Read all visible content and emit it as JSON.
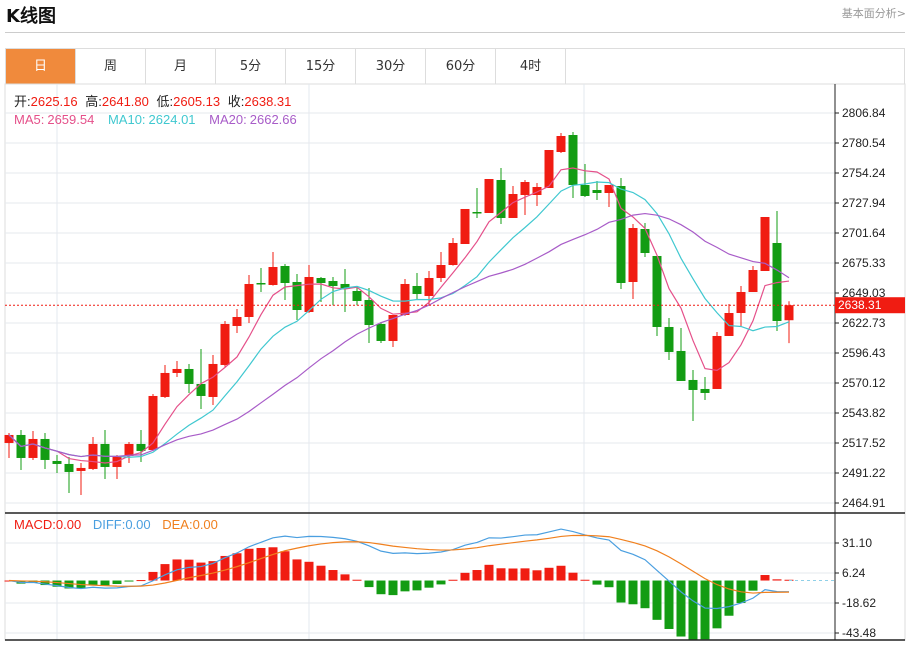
{
  "header": {
    "title": "K线图",
    "link": "基本面分析>"
  },
  "tabs": [
    {
      "label": "日",
      "active": true
    },
    {
      "label": "周"
    },
    {
      "label": "月"
    },
    {
      "label": "5分"
    },
    {
      "label": "15分"
    },
    {
      "label": "30分"
    },
    {
      "label": "60分"
    },
    {
      "label": "4时"
    }
  ],
  "info": {
    "open_label": "开:",
    "open": "2625.16",
    "high_label": "高:",
    "high": "2641.80",
    "low_label": "低:",
    "low": "2605.13",
    "close_label": "收:",
    "close": "2638.31",
    "ma5_label": "MA5:",
    "ma5": "2659.54",
    "ma10_label": "MA10:",
    "ma10": "2624.01",
    "ma20_label": "MA20:",
    "ma20": "2662.66"
  },
  "macd_info": {
    "macd": "MACD:0.00",
    "diff": "DIFF:0.00",
    "dea": "DEA:0.00"
  },
  "colors": {
    "up": "#f01c12",
    "down": "#139c13",
    "ma5": "#e5508a",
    "ma10": "#40c8d0",
    "ma20": "#a85cc8",
    "diff": "#4a9fe0",
    "dea": "#f0801e",
    "accent": "#f08a3c"
  },
  "chart_data": {
    "type": "candlestick",
    "price_axis": {
      "ticks": [
        "2806.84",
        "2780.54",
        "2754.24",
        "2727.94",
        "2701.64",
        "2675.33",
        "2649.03",
        "2622.73",
        "2596.43",
        "2570.12",
        "2543.82",
        "2517.52",
        "2491.22",
        "2464.91"
      ],
      "range": [
        2464.91,
        2806.84
      ]
    },
    "last_price": "2638.31",
    "macd_axis": {
      "ticks": [
        "31.10",
        "6.24",
        "-18.62",
        "-43.48"
      ],
      "range": [
        -43.48,
        31.1
      ]
    },
    "ohlc": [
      [
        2517.54,
        2526.3,
        2504.39,
        2524.55
      ],
      [
        2524.55,
        2528.93,
        2493.88,
        2504.39
      ],
      [
        2504.39,
        2528.05,
        2502.64,
        2521.04
      ],
      [
        2521.04,
        2526.3,
        2494.75,
        2502.64
      ],
      [
        2501.76,
        2507.02,
        2491.25,
        2499.13
      ],
      [
        2499.13,
        2505.27,
        2473.72,
        2492.12
      ],
      [
        2493.0,
        2500.01,
        2471.96,
        2495.63
      ],
      [
        2494.75,
        2522.8,
        2493.88,
        2516.66
      ],
      [
        2516.66,
        2528.93,
        2485.99,
        2496.5
      ],
      [
        2496.5,
        2507.02,
        2485.99,
        2505.27
      ],
      [
        2506.14,
        2518.41,
        2500.01,
        2516.66
      ],
      [
        2516.66,
        2528.93,
        2500.89,
        2510.53
      ],
      [
        2511.4,
        2560.49,
        2510.53,
        2558.74
      ],
      [
        2557.86,
        2585.92,
        2557.0,
        2578.91
      ],
      [
        2578.91,
        2589.43,
        2575.4,
        2582.41
      ],
      [
        2582.41,
        2586.8,
        2561.37,
        2569.26
      ],
      [
        2569.26,
        2599.95,
        2547.34,
        2558.74
      ],
      [
        2557.86,
        2594.69,
        2550.85,
        2586.8
      ],
      [
        2585.92,
        2624.48,
        2584.5,
        2621.86
      ],
      [
        2620.11,
        2634.99,
        2613.97,
        2627.99
      ],
      [
        2627.99,
        2664.81,
        2622.73,
        2656.92
      ],
      [
        2657.8,
        2670.95,
        2649.91,
        2656.92
      ],
      [
        2656.05,
        2684.98,
        2655.5,
        2671.82
      ],
      [
        2672.7,
        2674.45,
        2642.9,
        2657.8
      ],
      [
        2658.68,
        2665.69,
        2625.36,
        2634.12
      ],
      [
        2632.37,
        2673.57,
        2631.49,
        2663.06
      ],
      [
        2662.18,
        2663.06,
        2641.15,
        2657.8
      ],
      [
        2659.55,
        2663.06,
        2638.31,
        2655.17
      ],
      [
        2656.92,
        2670.07,
        2632.37,
        2652.54
      ],
      [
        2650.79,
        2654.29,
        2638.31,
        2642.03
      ],
      [
        2642.9,
        2653.42,
        2605.21,
        2620.98
      ],
      [
        2621.86,
        2623.61,
        2605.21,
        2606.96
      ],
      [
        2606.96,
        2629.74,
        2601.7,
        2629.74
      ],
      [
        2629.74,
        2661.31,
        2629.0,
        2656.92
      ],
      [
        2655.17,
        2666.56,
        2642.9,
        2648.16
      ],
      [
        2646.41,
        2668.32,
        2638.31,
        2662.18
      ],
      [
        2662.18,
        2684.98,
        2658.68,
        2673.57
      ],
      [
        2673.57,
        2697.25,
        2673.0,
        2692.87
      ],
      [
        2691.99,
        2722.68,
        2691.99,
        2722.68
      ],
      [
        2720.05,
        2741.08,
        2714.79,
        2719.17
      ],
      [
        2719.17,
        2748.97,
        2719.17,
        2748.97
      ],
      [
        2748.1,
        2758.62,
        2709.53,
        2714.79
      ],
      [
        2714.79,
        2742.84,
        2714.79,
        2735.82
      ],
      [
        2734.95,
        2748.1,
        2717.42,
        2746.34
      ],
      [
        2734.95,
        2745.47,
        2725.3,
        2741.96
      ],
      [
        2741.08,
        2774.4,
        2741.08,
        2774.4
      ],
      [
        2772.65,
        2789.3,
        2771.77,
        2786.67
      ],
      [
        2787.55,
        2790.18,
        2732.32,
        2743.72
      ],
      [
        2743.72,
        2762.12,
        2733.19,
        2734.07
      ],
      [
        2739.33,
        2747.22,
        2730.56,
        2736.7
      ],
      [
        2736.7,
        2743.72,
        2724.43,
        2743.72
      ],
      [
        2742.84,
        2749.85,
        2652.54,
        2657.8
      ],
      [
        2658.68,
        2709.53,
        2643.78,
        2706.02
      ],
      [
        2705.14,
        2710.4,
        2680.59,
        2684.09
      ],
      [
        2681.48,
        2681.48,
        2611.34,
        2619.23
      ],
      [
        2619.23,
        2627.11,
        2590.31,
        2597.32
      ],
      [
        2598.2,
        2618.36,
        2571.89,
        2571.89
      ],
      [
        2572.77,
        2581.54,
        2536.82,
        2564.0
      ],
      [
        2564.88,
        2575.4,
        2555.23,
        2561.37
      ],
      [
        2564.88,
        2614.85,
        2564.88,
        2611.34
      ],
      [
        2611.34,
        2639.4,
        2611.34,
        2631.49
      ],
      [
        2631.49,
        2655.17,
        2619.23,
        2649.91
      ],
      [
        2649.91,
        2672.7,
        2649.91,
        2669.19
      ],
      [
        2668.32,
        2715.66,
        2668.32,
        2715.66
      ],
      [
        2692.87,
        2720.9,
        2615.73,
        2624.48
      ],
      [
        2625.16,
        2641.8,
        2605.13,
        2638.31
      ]
    ],
    "moving_averages": [
      "MA5",
      "MA10",
      "MA20"
    ],
    "grid": true
  }
}
